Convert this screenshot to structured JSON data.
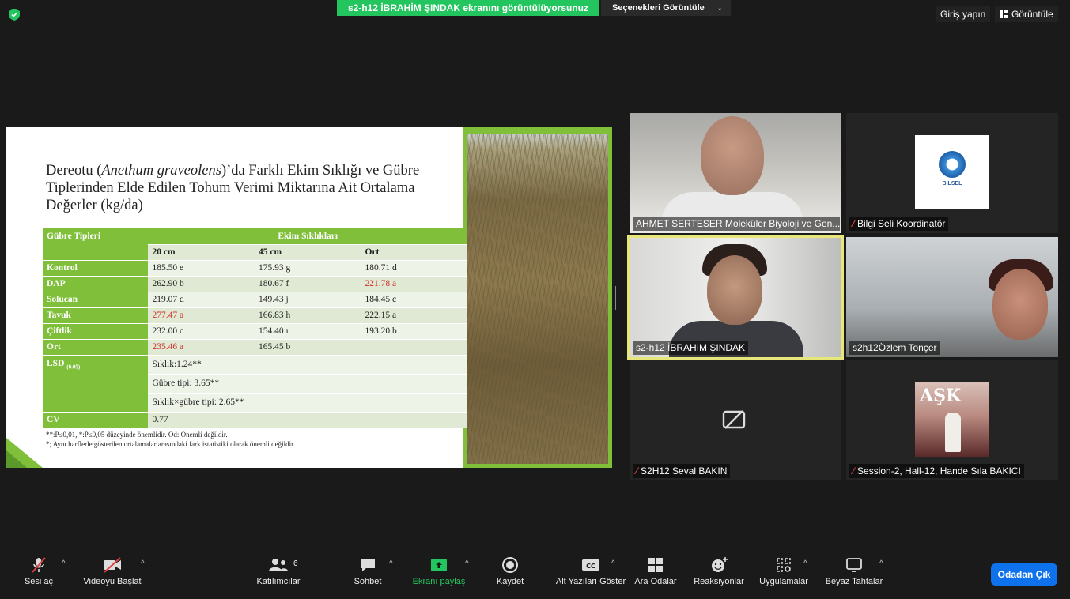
{
  "topbar": {
    "share_banner": "s2-h12 İBRAHİM ŞINDAK ekranını görüntülüyorsunuz",
    "view_options": "Seçenekleri Görüntüle",
    "login": "Giriş yapın",
    "view": "Görüntüle"
  },
  "slide": {
    "title_part1": "Dereotu (",
    "title_italic": "Anethum graveolens",
    "title_part2": ")’da Farklı Ekim Sıklığı ve Gübre Tiplerinden Elde Edilen Tohum Verimi Miktarına Ait Ortalama Değerler (kg/da)",
    "table": {
      "header_row_label": "Gübre Tipleri",
      "header_group": "Ekim Sıklıkları",
      "sub_headers": [
        "20 cm",
        "45 cm",
        "Ort"
      ],
      "rows": [
        {
          "label": "Kontrol",
          "c1": "185.50 e",
          "c2": "175.93 g",
          "c3": "180.71 d"
        },
        {
          "label": "DAP",
          "c1": "262.90 b",
          "c2": "180.67 f",
          "c3": "221.78 a"
        },
        {
          "label": "Solucan",
          "c1": "219.07 d",
          "c2": "149.43 j",
          "c3": "184.45 c"
        },
        {
          "label": "Tavuk",
          "c1": "277.47 a",
          "c2": "166.83 h",
          "c3": "222.15 a"
        },
        {
          "label": "Çiftlik",
          "c1": "232.00 c",
          "c2": "154.40 ı",
          "c3": "193.20 b"
        },
        {
          "label": "Ort",
          "c1": "235.46 a",
          "c2": "165.45 b",
          "c3": ""
        }
      ],
      "lsd_label": "LSD",
      "lsd_sub": "(0.05)",
      "lsd_values": [
        "Sıklık:1.24**",
        "Gübre tipi: 3.65**",
        "Sıklık×gübre tipi: 2.65**"
      ],
      "cv_label": "CV",
      "cv_value": "0.77"
    },
    "note1": "**:P≤0,01, *:P≤0,05 düzeyinde önemlidir. Öd: Önemli değildir.",
    "note2": "*; Aynı harflerle gösterilen ortalamalar arasındaki fark istatistiki olarak önemli değildir."
  },
  "participants": [
    {
      "name": "AHMET SERTESER Moleküler Biyoloji ve Gen..."
    },
    {
      "name": "Bilgi Seli Koordinatör",
      "logo_text": "BİLSEL"
    },
    {
      "name": "s2-h12 İBRAHİM ŞINDAK"
    },
    {
      "name": "s2h12Özlem Tonçer"
    },
    {
      "name": "S2H12 Seval BAKIN"
    },
    {
      "name": "Session-2, Hall-12, Hande Sıla BAKICI",
      "thumb_text": "AŞK"
    }
  ],
  "toolbar": {
    "unmute": "Sesi aç",
    "start_video": "Videoyu Başlat",
    "participants": "Katılımcılar",
    "participants_count": "6",
    "chat": "Sohbet",
    "share": "Ekranı paylaş",
    "record": "Kaydet",
    "captions": "Alt Yazıları Göster",
    "breakout": "Ara Odalar",
    "reactions": "Reaksiyonlar",
    "apps": "Uygulamalar",
    "whiteboards": "Beyaz Tahtalar",
    "leave": "Odadan Çık"
  },
  "colors": {
    "accent_green": "#23c55e",
    "slide_green": "#7fbf3a",
    "leave_blue": "#0e72ed",
    "highlight_red": "#d0302a"
  }
}
